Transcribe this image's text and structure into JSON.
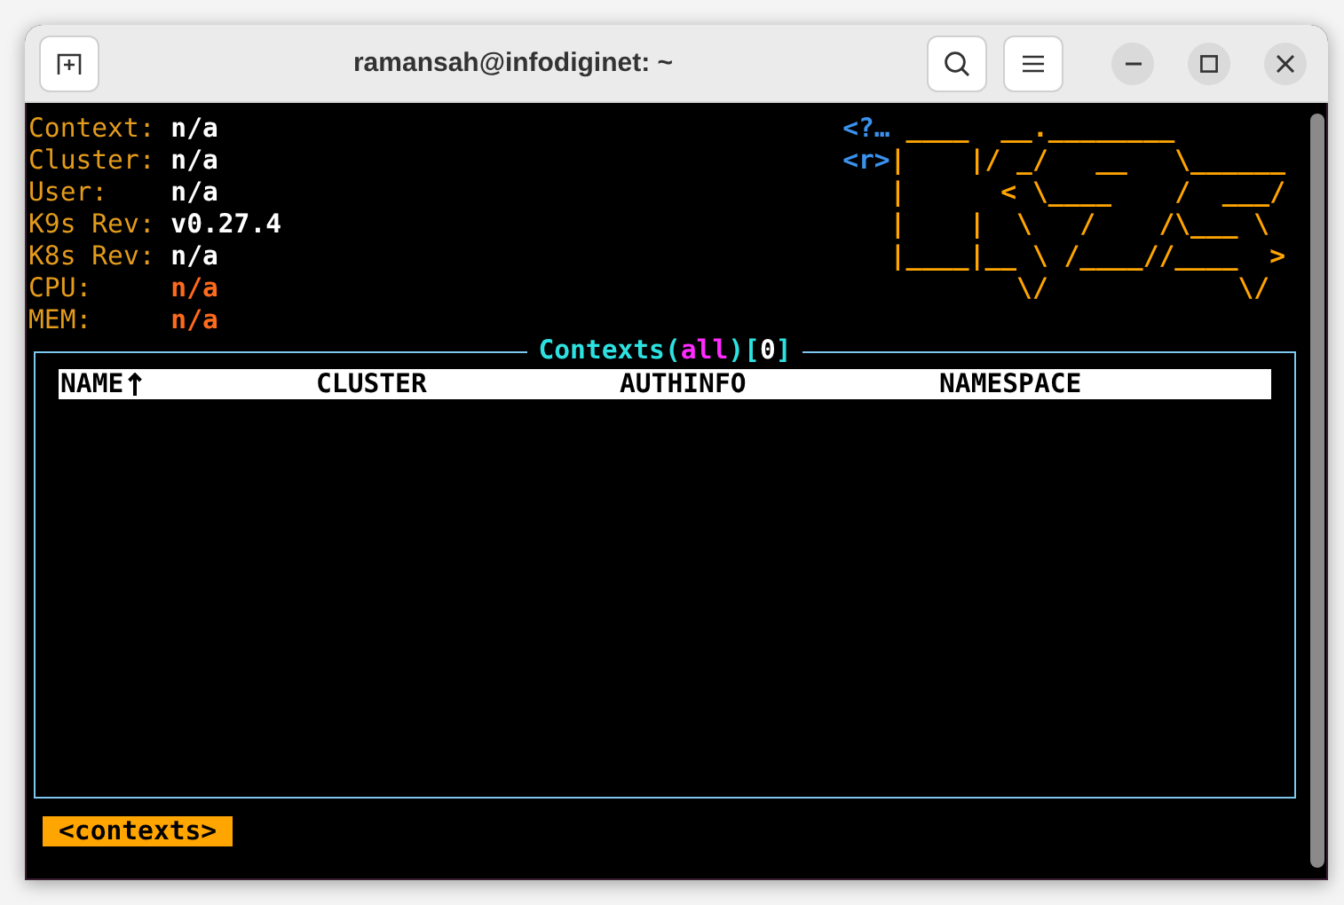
{
  "window": {
    "title": "ramansah@infodiginet: ~"
  },
  "info": [
    {
      "label": "Context:",
      "value": "n/a",
      "kind": "plain"
    },
    {
      "label": "Cluster:",
      "value": "n/a",
      "kind": "plain"
    },
    {
      "label": "User:",
      "value": "n/a",
      "kind": "plain"
    },
    {
      "label": "K9s Rev:",
      "value": "v0.27.4",
      "kind": "plain"
    },
    {
      "label": "K8s Rev:",
      "value": "n/a",
      "kind": "plain"
    },
    {
      "label": "CPU:",
      "value": "n/a",
      "kind": "metric"
    },
    {
      "label": "MEM:",
      "value": "n/a",
      "kind": "metric"
    }
  ],
  "hints": [
    "<?…",
    "<r>"
  ],
  "logo": [
    " ____  __.________",
    "|    |/ _/   __   \\______",
    "|      < \\____    /  ___/",
    "|    |  \\   /    /\\___ \\",
    "|____|__ \\ /____//____  >",
    "        \\/            \\/"
  ],
  "table": {
    "title": [
      {
        "text": "Contexts(",
        "kind": "name"
      },
      {
        "text": "all",
        "kind": "filter"
      },
      {
        "text": ")[",
        "kind": "name"
      },
      {
        "text": "0",
        "kind": "count"
      },
      {
        "text": "]",
        "kind": "name"
      }
    ],
    "columns": [
      {
        "label": "NAME",
        "sorted": true
      },
      {
        "label": "CLUSTER",
        "sorted": false
      },
      {
        "label": "AUTHINFO",
        "sorted": false
      },
      {
        "label": "NAMESPACE",
        "sorted": false
      }
    ]
  },
  "crumbs": [
    "<contexts>"
  ]
}
